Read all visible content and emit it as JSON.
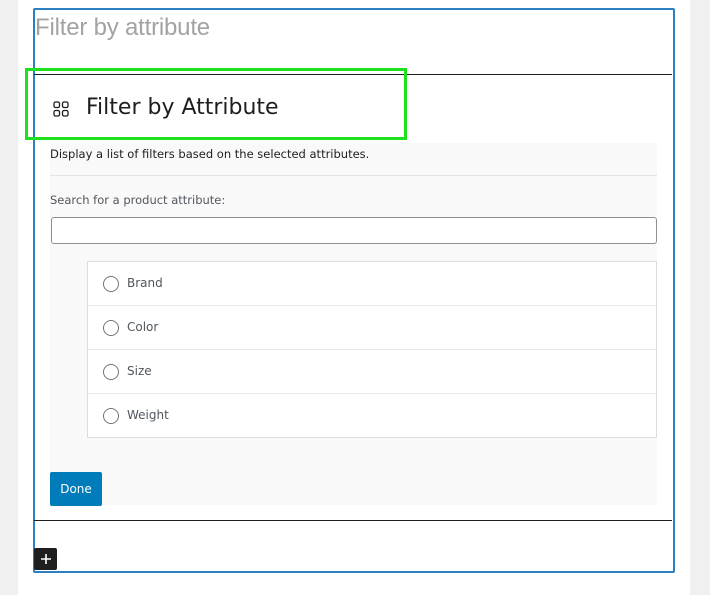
{
  "block": {
    "title": "Filter by attribute"
  },
  "placeholder": {
    "heading": "Filter by Attribute",
    "description": "Display a list of filters based on the selected attributes.",
    "search_label": "Search for a product attribute:",
    "search_value": "",
    "options": [
      {
        "label": "Brand",
        "checked": false
      },
      {
        "label": "Color",
        "checked": false
      },
      {
        "label": "Size",
        "checked": false
      },
      {
        "label": "Weight",
        "checked": false
      }
    ],
    "done_label": "Done"
  },
  "colors": {
    "accent": "#007cba",
    "block_border": "#2c7fc1",
    "highlight": "#1ee11e"
  },
  "icons": {
    "block_icon": "grid-icon",
    "add": "plus-icon"
  }
}
